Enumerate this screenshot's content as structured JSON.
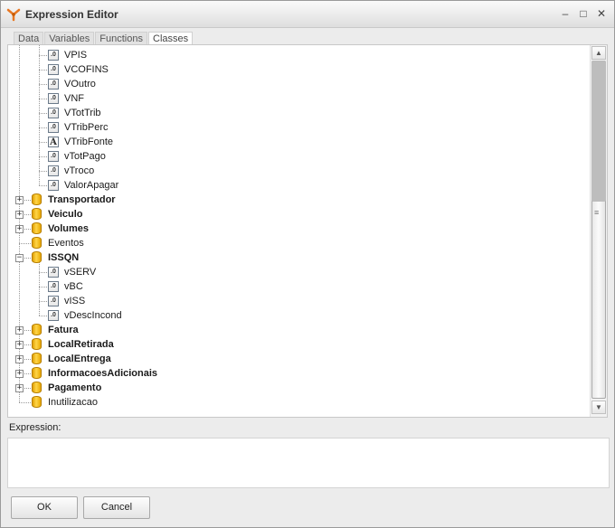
{
  "window": {
    "title": "Expression Editor"
  },
  "titlebar_buttons": {
    "minimize": "–",
    "maximize": "□",
    "close": "✕"
  },
  "tabs": [
    {
      "label": "Data",
      "active": false
    },
    {
      "label": "Variables",
      "active": false
    },
    {
      "label": "Functions",
      "active": false
    },
    {
      "label": "Classes",
      "active": true
    }
  ],
  "tree": {
    "rows": [
      {
        "label": "VPIS",
        "icon": "numeric-field-icon",
        "level": 2,
        "bold": false
      },
      {
        "label": "VCOFINS",
        "icon": "numeric-field-icon",
        "level": 2,
        "bold": false
      },
      {
        "label": "VOutro",
        "icon": "numeric-field-icon",
        "level": 2,
        "bold": false
      },
      {
        "label": "VNF",
        "icon": "numeric-field-icon",
        "level": 2,
        "bold": false
      },
      {
        "label": "VTotTrib",
        "icon": "numeric-field-icon",
        "level": 2,
        "bold": false
      },
      {
        "label": "VTribPerc",
        "icon": "numeric-field-icon",
        "level": 2,
        "bold": false
      },
      {
        "label": "VTribFonte",
        "icon": "text-field-icon",
        "level": 2,
        "bold": false
      },
      {
        "label": "vTotPago",
        "icon": "numeric-field-icon",
        "level": 2,
        "bold": false
      },
      {
        "label": "vTroco",
        "icon": "numeric-field-icon",
        "level": 2,
        "bold": false
      },
      {
        "label": "ValorApagar",
        "icon": "numeric-field-icon",
        "level": 2,
        "bold": false
      },
      {
        "label": "Transportador",
        "icon": "database-icon",
        "level": 1,
        "bold": true,
        "expander": "+"
      },
      {
        "label": "Veiculo",
        "icon": "database-icon",
        "level": 1,
        "bold": true,
        "expander": "+"
      },
      {
        "label": "Volumes",
        "icon": "database-icon",
        "level": 1,
        "bold": true,
        "expander": "+"
      },
      {
        "label": "Eventos",
        "icon": "database-icon",
        "level": 1,
        "bold": false
      },
      {
        "label": "ISSQN",
        "icon": "database-icon",
        "level": 1,
        "bold": true,
        "expander": "−"
      },
      {
        "label": "vSERV",
        "icon": "numeric-field-icon",
        "level": 2,
        "bold": false
      },
      {
        "label": "vBC",
        "icon": "numeric-field-icon",
        "level": 2,
        "bold": false
      },
      {
        "label": "vISS",
        "icon": "numeric-field-icon",
        "level": 2,
        "bold": false
      },
      {
        "label": "vDescIncond",
        "icon": "numeric-field-icon",
        "level": 2,
        "bold": false
      },
      {
        "label": "Fatura",
        "icon": "database-icon",
        "level": 1,
        "bold": true,
        "expander": "+"
      },
      {
        "label": "LocalRetirada",
        "icon": "database-icon",
        "level": 1,
        "bold": true,
        "expander": "+"
      },
      {
        "label": "LocalEntrega",
        "icon": "database-icon",
        "level": 1,
        "bold": true,
        "expander": "+"
      },
      {
        "label": "InformacoesAdicionais",
        "icon": "database-icon",
        "level": 1,
        "bold": true,
        "expander": "+"
      },
      {
        "label": "Pagamento",
        "icon": "database-icon",
        "level": 1,
        "bold": true,
        "expander": "+"
      },
      {
        "label": "Inutilizacao",
        "icon": "database-icon",
        "level": 1,
        "bold": false
      }
    ]
  },
  "icons": {
    "numeric_glyph": ".0",
    "text_glyph": "A"
  },
  "scrollbar": {
    "up": "▲",
    "down": "▼",
    "grip": "≡"
  },
  "expression": {
    "label": "Expression:",
    "value": ""
  },
  "buttons": {
    "ok": "OK",
    "cancel": "Cancel"
  }
}
